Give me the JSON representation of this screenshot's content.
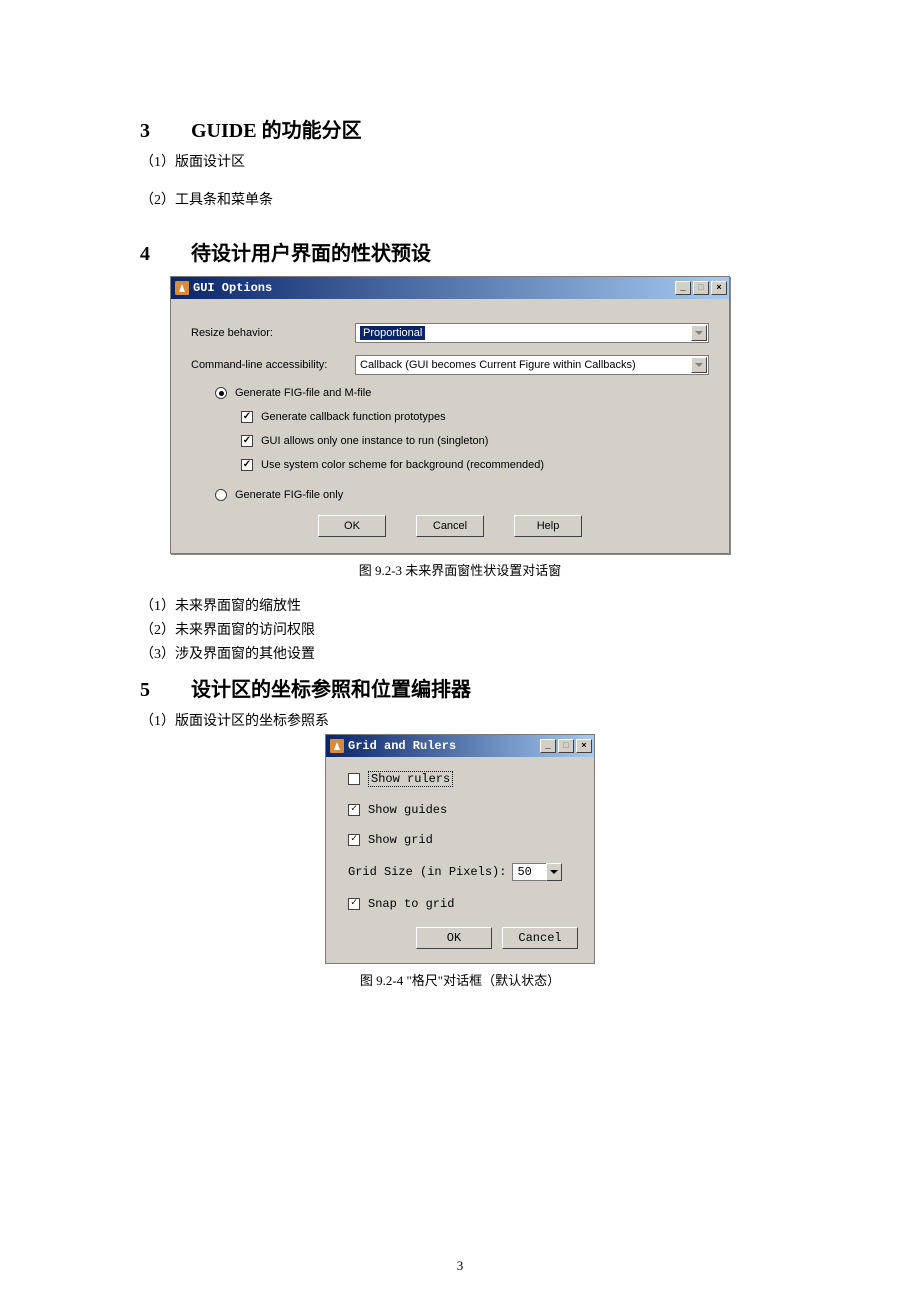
{
  "page_number": "3",
  "sections": {
    "s3": {
      "num": "3",
      "title": "GUIDE 的功能分区"
    },
    "s3_items": [
      "（1）版面设计区",
      "（2）工具条和菜单条"
    ],
    "s4": {
      "num": "4",
      "title": "待设计用户界面的性状预设"
    },
    "s5": {
      "num": "5",
      "title": "设计区的坐标参照和位置编排器"
    },
    "s5_item": "（1）版面设计区的坐标参照系",
    "post_fig1": [
      "（1）未来界面窗的缩放性",
      "（2）未来界面窗的访问权限",
      "（3）涉及界面窗的其他设置"
    ]
  },
  "figure1": {
    "title": "GUI Options",
    "resize_label": "Resize behavior:",
    "resize_value": "Proportional",
    "cmdline_label": "Command-line accessibility:",
    "cmdline_value": "Callback (GUI becomes Current Figure within Callbacks)",
    "radio1": "Generate FIG-file and M-file",
    "check1": "Generate callback function prototypes",
    "check2": "GUI allows only one instance to run (singleton)",
    "check3": "Use system color scheme for background (recommended)",
    "radio2": "Generate FIG-file only",
    "btn_ok": "OK",
    "btn_cancel": "Cancel",
    "btn_help": "Help",
    "caption": "图 9.2-3  未来界面窗性状设置对话窗"
  },
  "figure2": {
    "title": "Grid and Rulers",
    "show_rulers": "Show rulers",
    "show_guides": "Show guides",
    "show_grid": "Show grid",
    "grid_size_label": "Grid Size (in Pixels):",
    "grid_size_value": "50",
    "snap": "Snap to grid",
    "btn_ok": "OK",
    "btn_cancel": "Cancel",
    "caption": "图 9.2-4  \"格尺\"对话框（默认状态）"
  }
}
